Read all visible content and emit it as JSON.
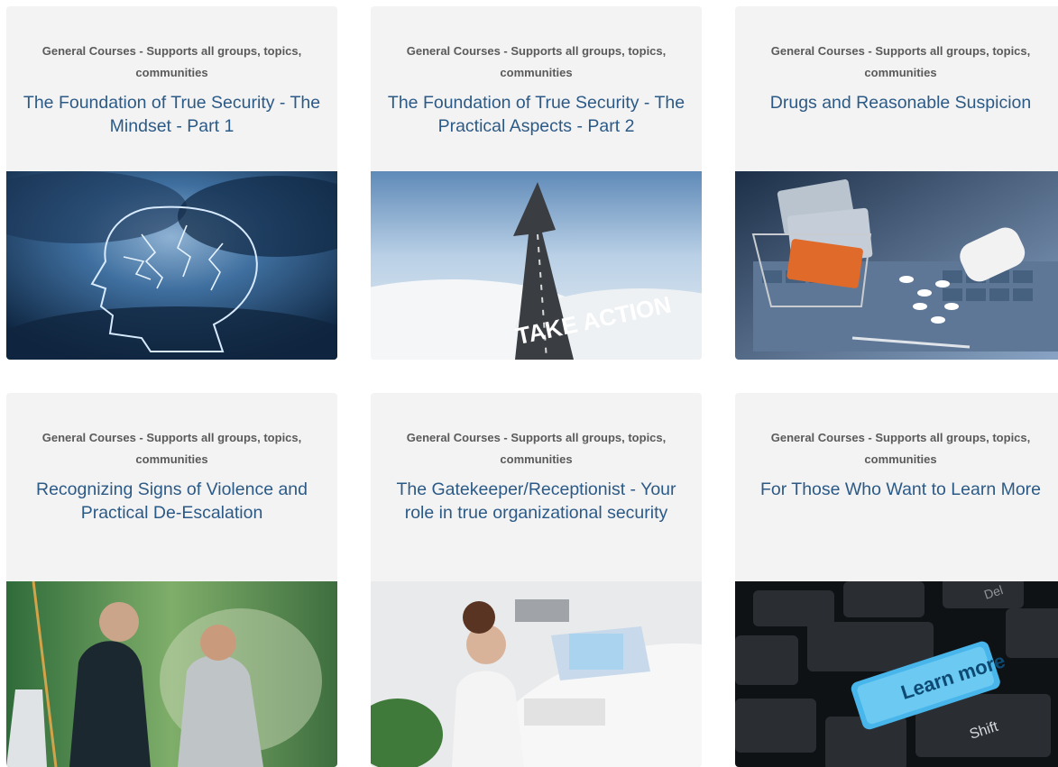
{
  "courses": [
    {
      "category": "General Courses - Supports all groups, topics, communities",
      "title": "The Foundation of True Security - The Mindset - Part 1",
      "image": "storm-head-image"
    },
    {
      "category": "General Courses - Supports all groups, topics, communities",
      "title": "The Foundation of True Security - The Practical Aspects - Part 2",
      "image": "take-action-road-image",
      "image_text": "TAKE ACTION"
    },
    {
      "category": "General Courses - Supports all groups, topics, communities",
      "title": "Drugs and Reasonable Suspicion",
      "image": "pills-laptop-image"
    },
    {
      "category": "General Courses - Supports all groups, topics, communities",
      "title": "Recognizing Signs of Violence and Practical De-Escalation",
      "image": "confrontation-image"
    },
    {
      "category": "General Courses - Supports all groups, topics, communities",
      "title": "The Gatekeeper/Receptionist - Your role in true organizational security",
      "image": "receptionist-image"
    },
    {
      "category": "General Courses - Supports all groups, topics, communities",
      "title": "For Those Who Want to Learn More",
      "image": "learn-more-keyboard-image",
      "image_text": "Learn more",
      "keys": {
        "shift": "Shift",
        "del": "Del"
      }
    }
  ]
}
